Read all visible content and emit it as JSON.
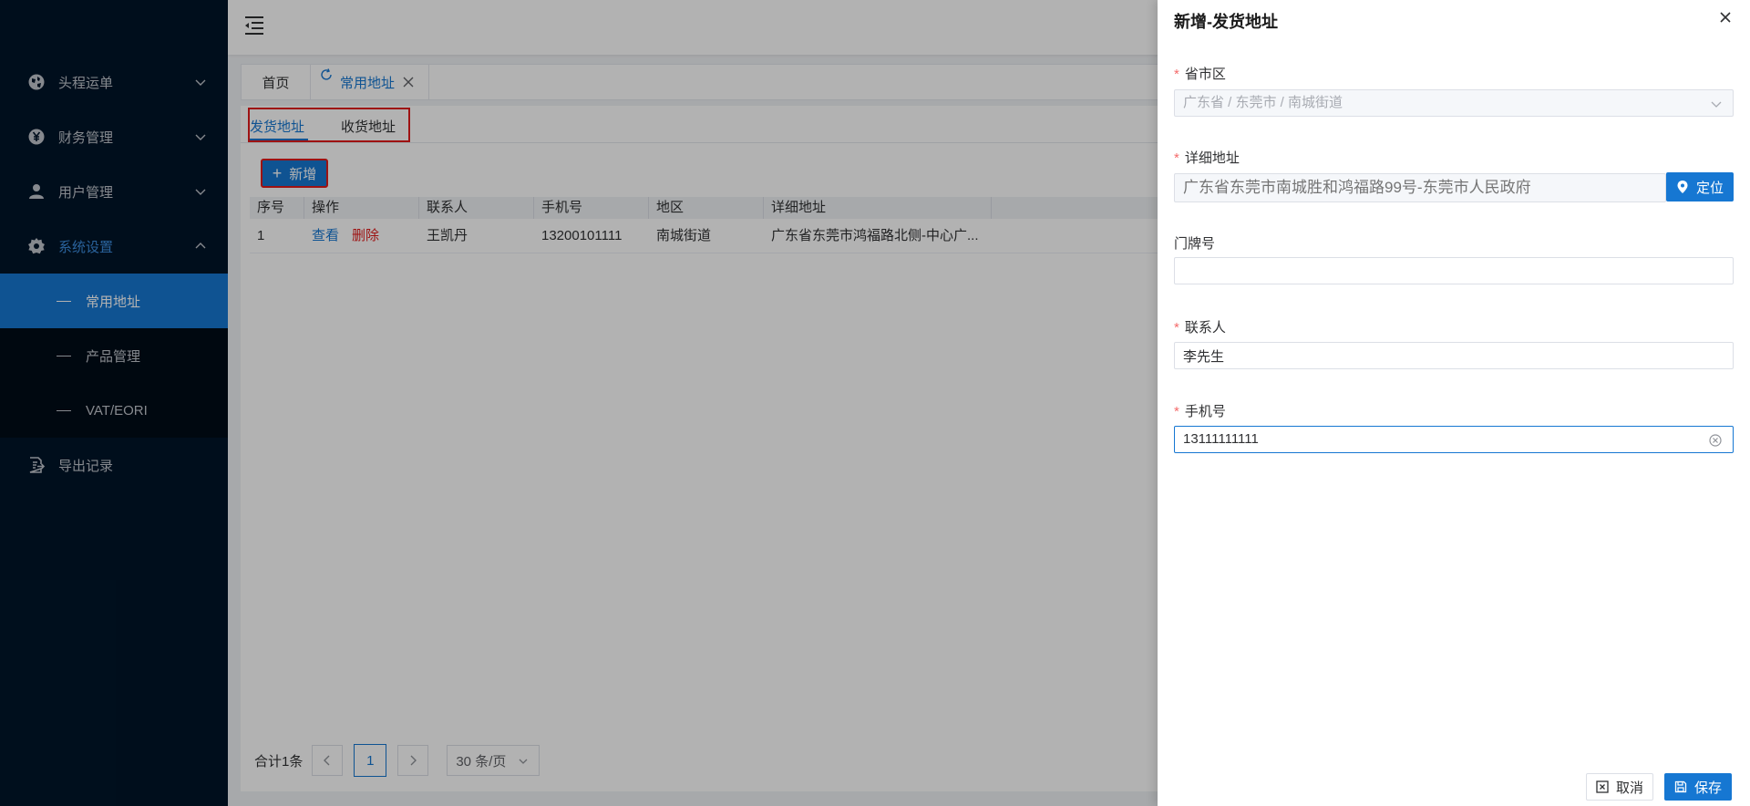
{
  "sidebar": {
    "items": [
      {
        "label": "头程运单",
        "icon": "globe-icon"
      },
      {
        "label": "财务管理",
        "icon": "yen-icon"
      },
      {
        "label": "用户管理",
        "icon": "user-icon"
      },
      {
        "label": "系统设置",
        "icon": "gear-icon"
      },
      {
        "label": "导出记录",
        "icon": "export-icon"
      }
    ],
    "sub_items": [
      {
        "label": "常用地址"
      },
      {
        "label": "产品管理"
      },
      {
        "label": "VAT/EORI"
      }
    ]
  },
  "tabs": {
    "home": "首页",
    "current": "常用地址"
  },
  "content": {
    "sub_tabs": [
      "发货地址",
      "收货地址"
    ],
    "add_label": "新增",
    "columns": [
      "序号",
      "操作",
      "联系人",
      "手机号",
      "地区",
      "详细地址"
    ],
    "rows": [
      {
        "index": "1",
        "view": "查看",
        "del": "删除",
        "contact": "王凯丹",
        "phone": "13200101111",
        "region": "南城街道",
        "address": "广东省东莞市鸿福路北侧-中心广..."
      }
    ],
    "pager": {
      "total": "合计1条",
      "page": "1",
      "size": "30 条/页"
    }
  },
  "drawer": {
    "title": "新增-发货地址",
    "region_label": "省市区",
    "region_value": "广东省 / 东莞市 / 南城街道",
    "address_label": "详细地址",
    "address_placeholder": "广东省东莞市南城胜和鸿福路99号-东莞市人民政府",
    "locate_label": "定位",
    "door_label": "门牌号",
    "door_value": "",
    "contact_label": "联系人",
    "contact_value": "李先生",
    "phone_label": "手机号",
    "phone_value": "13111111111",
    "cancel_label": "取消",
    "save_label": "保存"
  },
  "colors": {
    "primary": "#1677d2",
    "sidebar_bg": "#001529",
    "danger": "#e21a1a",
    "required": "#f56c6c"
  }
}
